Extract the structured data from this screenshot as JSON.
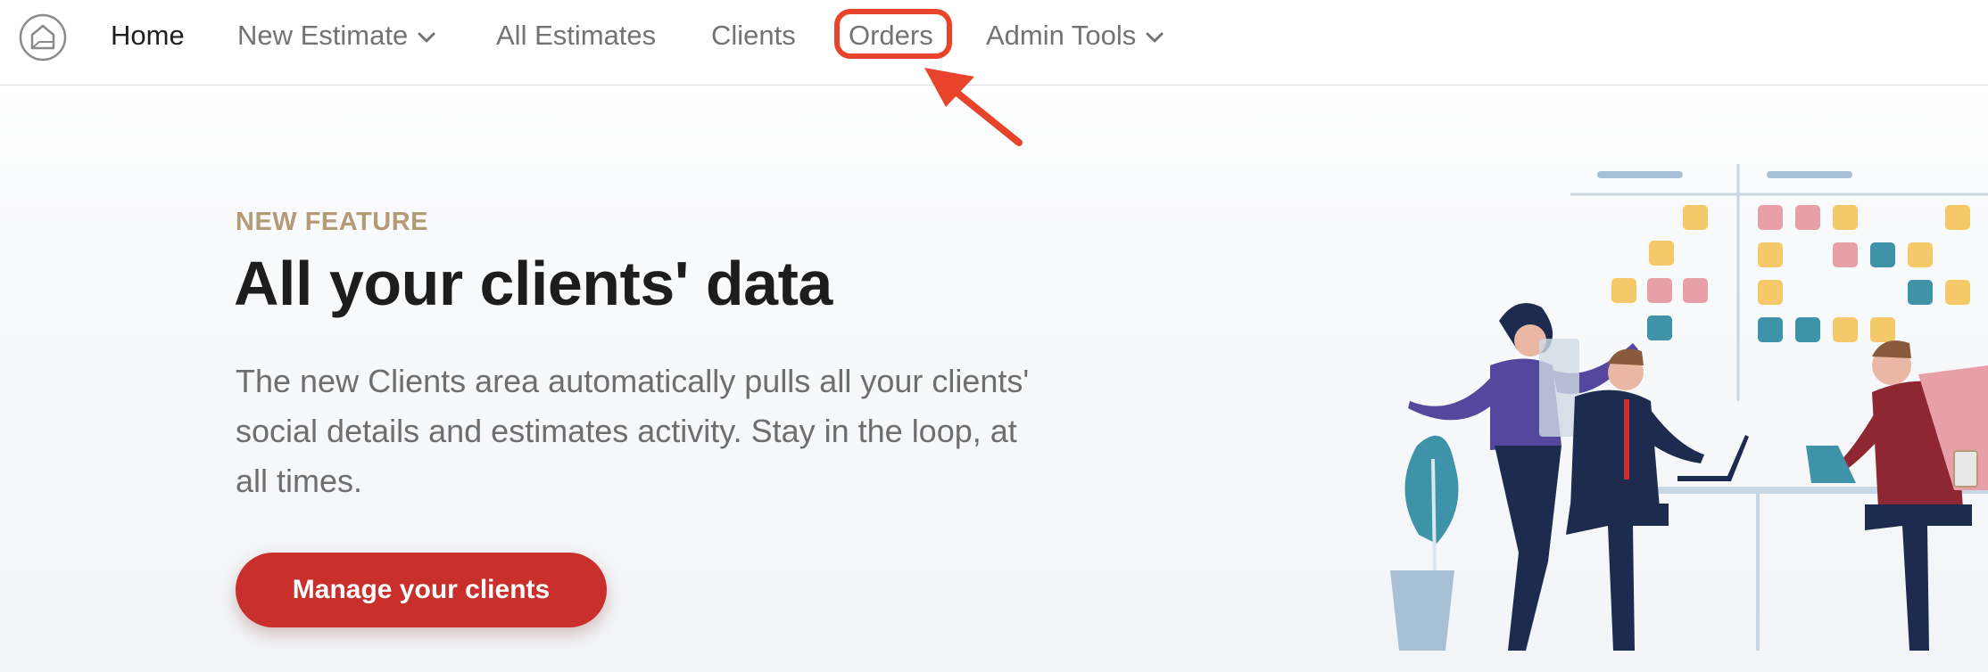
{
  "nav": {
    "home": "Home",
    "new_estimate": "New Estimate",
    "all_estimates": "All Estimates",
    "clients": "Clients",
    "orders": "Orders",
    "admin_tools": "Admin Tools"
  },
  "hero": {
    "eyebrow": "NEW FEATURE",
    "title": "All your clients' data",
    "description": "The new Clients area automatically pulls all your clients' social details and estimates activity. Stay in the loop, at all times.",
    "cta": "Manage your clients"
  },
  "colors": {
    "brand_red": "#c9302c",
    "annotation_red": "#e8432b",
    "eyebrow_tan": "#b39b78"
  },
  "icons": {
    "logo": "house-icon",
    "dropdown": "chevron-down-icon",
    "annotation": "arrow-icon"
  }
}
